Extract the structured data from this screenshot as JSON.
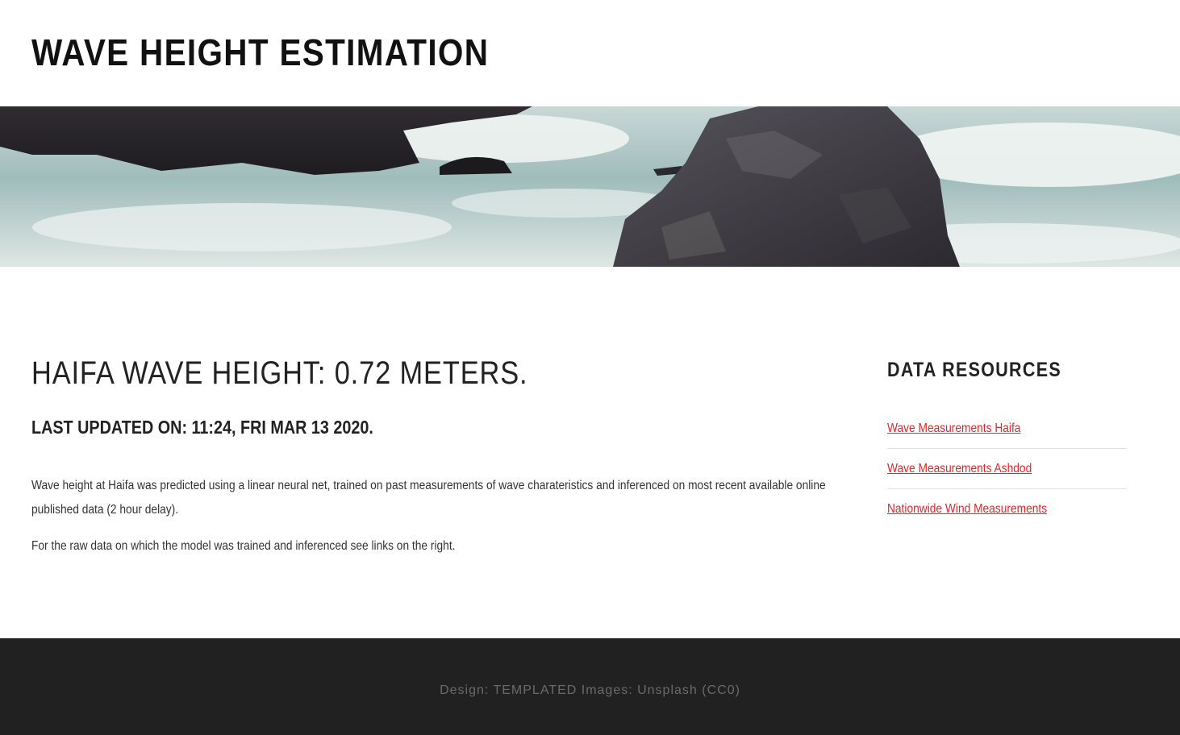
{
  "header": {
    "title": "WAVE HEIGHT ESTIMATION"
  },
  "banner": {
    "image": "ocean-waves-rocks-image"
  },
  "main": {
    "headline": "HAIFA WAVE HEIGHT: 0.72 METERS.",
    "updated": "LAST UPDATED ON: 11:24, FRI MAR 13 2020.",
    "paragraphs": [
      "Wave height at Haifa was predicted using a linear neural net, trained on past measurements of wave charateristics and inferenced on most recent available online published data (2 hour delay).",
      "For the raw data on which the model was trained and inferenced see links on the right."
    ]
  },
  "sidebar": {
    "title": "DATA RESOURCES",
    "links": [
      {
        "label": "Wave Measurements Haifa"
      },
      {
        "label": "Wave Measurements Ashdod"
      },
      {
        "label": "Nationwide Wind Measurements"
      }
    ]
  },
  "footer": {
    "copyright": "Design: TEMPLATED Images: Unsplash (CC0)"
  },
  "colors": {
    "link": "#e0262b",
    "footer_bg": "#212121",
    "footer_text": "#6a6a6a"
  }
}
